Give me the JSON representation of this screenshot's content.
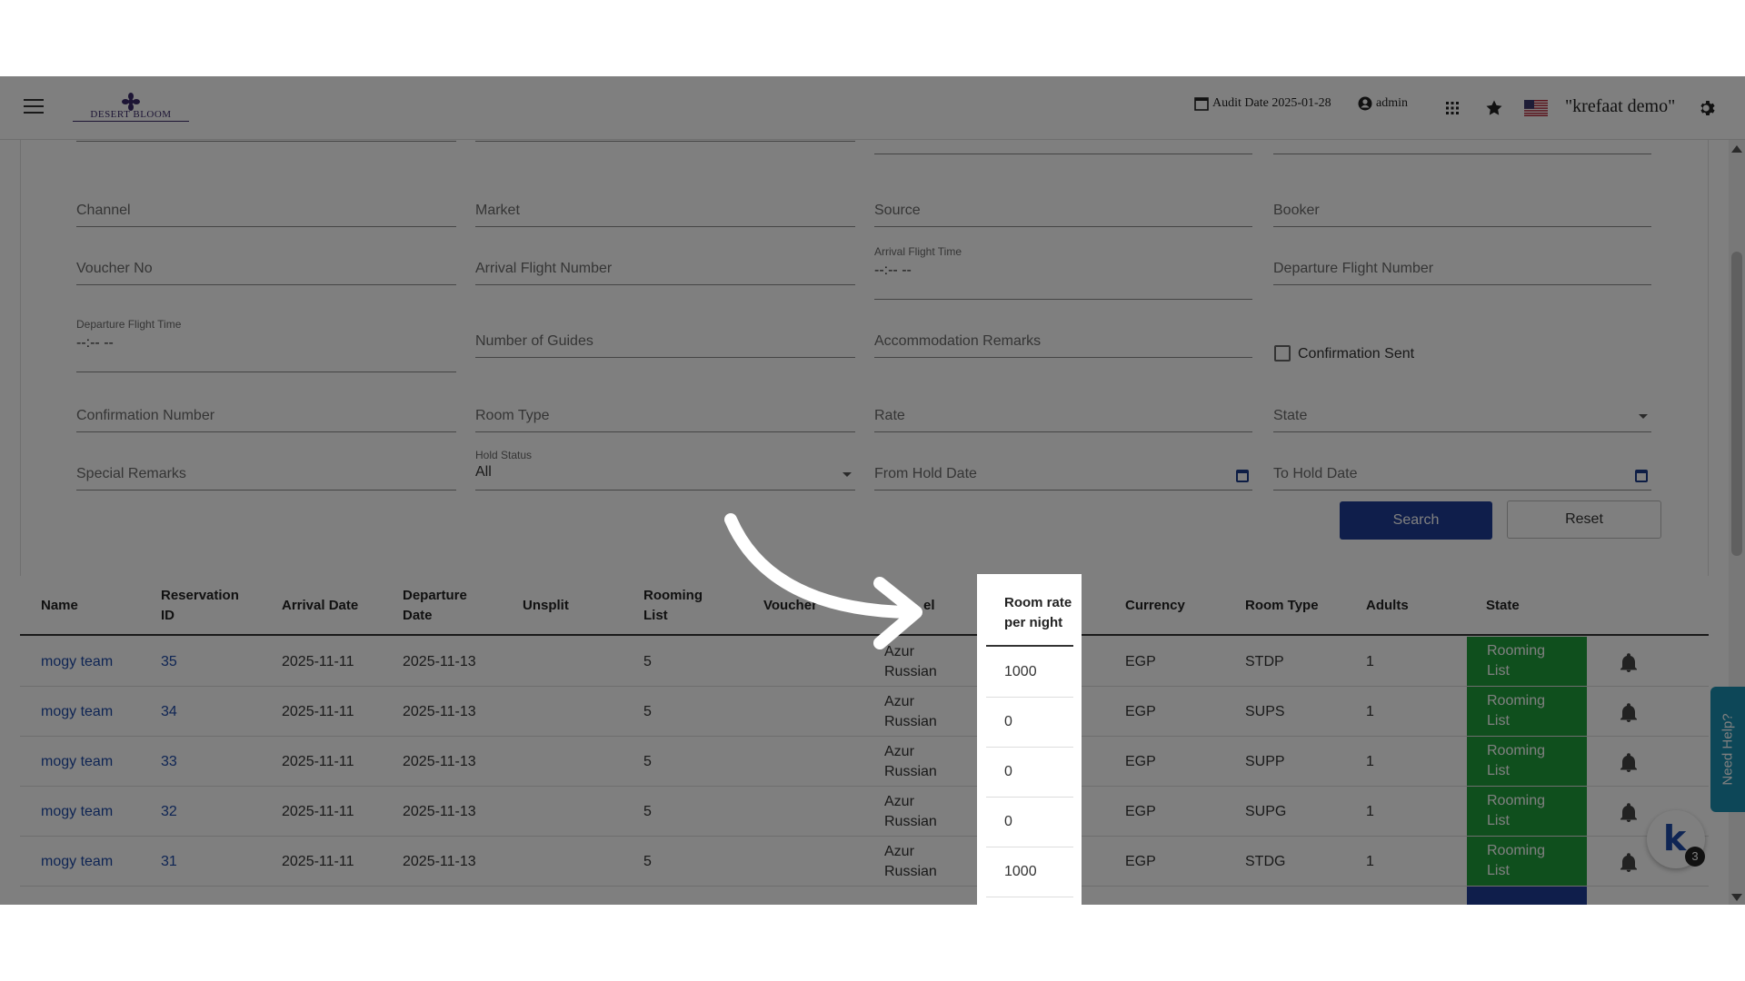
{
  "header": {
    "audit_date": "Audit Date 2025-01-28",
    "user": "admin",
    "demo_name": "\"krefaat demo\"",
    "logo_text": "DESERT BLOOM"
  },
  "form": {
    "channel": "Channel",
    "market": "Market",
    "source": "Source",
    "booker": "Booker",
    "voucher_no": "Voucher No",
    "arrival_flight_number": "Arrival Flight Number",
    "arrival_flight_time_label": "Arrival Flight Time",
    "arrival_flight_time_value": "--:-- --",
    "departure_flight_number": "Departure Flight Number",
    "departure_flight_time_label": "Departure Flight Time",
    "departure_flight_time_value": "--:-- --",
    "number_of_guides": "Number of Guides",
    "accommodation_remarks": "Accommodation Remarks",
    "confirmation_sent": "Confirmation Sent",
    "confirmation_number": "Confirmation Number",
    "room_type": "Room Type",
    "rate": "Rate",
    "state": "State",
    "special_remarks": "Special Remarks",
    "hold_status_label": "Hold Status",
    "hold_status_value": "All",
    "from_hold_date": "From Hold Date",
    "to_hold_date": "To Hold Date",
    "search_button": "Search",
    "reset_button": "Reset"
  },
  "table": {
    "headers": {
      "name": "Name",
      "reservation_id_1": "Reservation",
      "reservation_id_2": "ID",
      "arrival_date": "Arrival Date",
      "departure_date_1": "Departure",
      "departure_date_2": "Date",
      "unsplit": "Unsplit",
      "rooming_list_1": "Rooming",
      "rooming_list_2": "List",
      "voucher": "Voucher",
      "hotel_partial": "el",
      "room_rate_1": "Room rate",
      "room_rate_2": "per night",
      "currency": "Currency",
      "room_type": "Room Type",
      "adults": "Adults",
      "state": "State"
    },
    "rows": [
      {
        "name": "mogy team",
        "id": "35",
        "arrival": "2025-11-11",
        "departure": "2025-11-13",
        "rooming": "5",
        "hotel_1": "Azur",
        "hotel_2": "Russian",
        "rate": "1000",
        "currency": "EGP",
        "room_type": "STDP",
        "adults": "1",
        "state_1": "Rooming",
        "state_2": "List"
      },
      {
        "name": "mogy team",
        "id": "34",
        "arrival": "2025-11-11",
        "departure": "2025-11-13",
        "rooming": "5",
        "hotel_1": "Azur",
        "hotel_2": "Russian",
        "rate": "0",
        "currency": "EGP",
        "room_type": "SUPS",
        "adults": "1",
        "state_1": "Rooming",
        "state_2": "List"
      },
      {
        "name": "mogy team",
        "id": "33",
        "arrival": "2025-11-11",
        "departure": "2025-11-13",
        "rooming": "5",
        "hotel_1": "Azur",
        "hotel_2": "Russian",
        "rate": "0",
        "currency": "EGP",
        "room_type": "SUPP",
        "adults": "1",
        "state_1": "Rooming",
        "state_2": "List"
      },
      {
        "name": "mogy team",
        "id": "32",
        "arrival": "2025-11-11",
        "departure": "2025-11-13",
        "rooming": "5",
        "hotel_1": "Azur",
        "hotel_2": "Russian",
        "rate": "0",
        "currency": "EGP",
        "room_type": "SUPG",
        "adults": "1",
        "state_1": "Rooming",
        "state_2": "List"
      },
      {
        "name": "mogy team",
        "id": "31",
        "arrival": "2025-11-11",
        "departure": "2025-11-13",
        "rooming": "5",
        "hotel_1": "Azur",
        "hotel_2": "Russian",
        "rate": "1000",
        "currency": "EGP",
        "room_type": "STDG",
        "adults": "1",
        "state_1": "Rooming",
        "state_2": "List"
      }
    ]
  },
  "help_tab": "Need Help?",
  "notification_count": "3",
  "colors": {
    "primary": "#1e3c96",
    "state_green": "#1e9e3a",
    "link": "#1e4aa8",
    "help_tab": "#1a8fb0"
  }
}
